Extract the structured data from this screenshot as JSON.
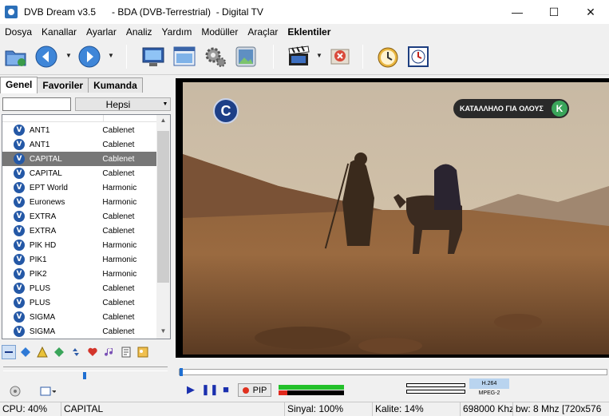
{
  "window": {
    "title": "DVB Dream v3.5      - BDA (DVB-Terrestrial)  - Digital TV",
    "controls": {
      "minimize": "—",
      "maximize": "☐",
      "close": "✕"
    }
  },
  "menu": [
    "Dosya",
    "Kanallar",
    "Ayarlar",
    "Analiz",
    "Yardım",
    "Modüller",
    "Araçlar",
    "Eklentiler"
  ],
  "toolbar": {
    "icons": [
      "open-folder-icon",
      "back-icon",
      "forward-icon",
      "monitor-icon",
      "screen-settings-icon",
      "gear-icon",
      "photo-icon",
      "record-clapper-icon",
      "stop-record-icon",
      "timer-clock-icon",
      "scheduler-icon"
    ]
  },
  "tabs": [
    "Genel",
    "Favoriler",
    "Kumanda"
  ],
  "filter": {
    "value": "",
    "select": "Hepsi"
  },
  "channels": [
    {
      "name": "ANT1",
      "provider": "Cablenet",
      "selected": false
    },
    {
      "name": "ANT1",
      "provider": "Cablenet",
      "selected": false
    },
    {
      "name": "CAPITAL",
      "provider": "Cablenet",
      "selected": true
    },
    {
      "name": "CAPITAL",
      "provider": "Cablenet",
      "selected": false
    },
    {
      "name": "EPT World",
      "provider": "Harmonic",
      "selected": false
    },
    {
      "name": "Euronews",
      "provider": "Harmonic",
      "selected": false
    },
    {
      "name": "EXTRA",
      "provider": "Cablenet",
      "selected": false
    },
    {
      "name": "EXTRA",
      "provider": "Cablenet",
      "selected": false
    },
    {
      "name": "PIK HD",
      "provider": "Harmonic",
      "selected": false
    },
    {
      "name": "PIK1",
      "provider": "Harmonic",
      "selected": false
    },
    {
      "name": "PIK2",
      "provider": "Harmonic",
      "selected": false
    },
    {
      "name": "PLUS",
      "provider": "Cablenet",
      "selected": false
    },
    {
      "name": "PLUS",
      "provider": "Cablenet",
      "selected": false
    },
    {
      "name": "SIGMA",
      "provider": "Cablenet",
      "selected": false
    },
    {
      "name": "SIGMA",
      "provider": "Cablenet",
      "selected": false
    }
  ],
  "channel_icon_glyph": "V",
  "video": {
    "logo_glyph": "C",
    "banner_text": "ΚΑΤΑΛΛΗΛΟ ΓΙΑ ΟΛΟΥΣ",
    "banner_badge": "K"
  },
  "player": {
    "pip_label": "PIP",
    "video_codec": "H.264",
    "audio_codec": "MPEG-2",
    "signal_level": 1.0,
    "quality_level": 0.14
  },
  "status": {
    "cpu": "CPU: 40%",
    "channel": "CAPITAL",
    "signal": "Sinyal: 100%",
    "quality": "Kalite: 14%",
    "frequency": "698000 Khz",
    "bandwidth": "bw: 8 Mhz [720x576"
  },
  "colors": {
    "accent": "#1f6fd1",
    "selection": "#777777",
    "control_blue": "#1a2fae"
  }
}
